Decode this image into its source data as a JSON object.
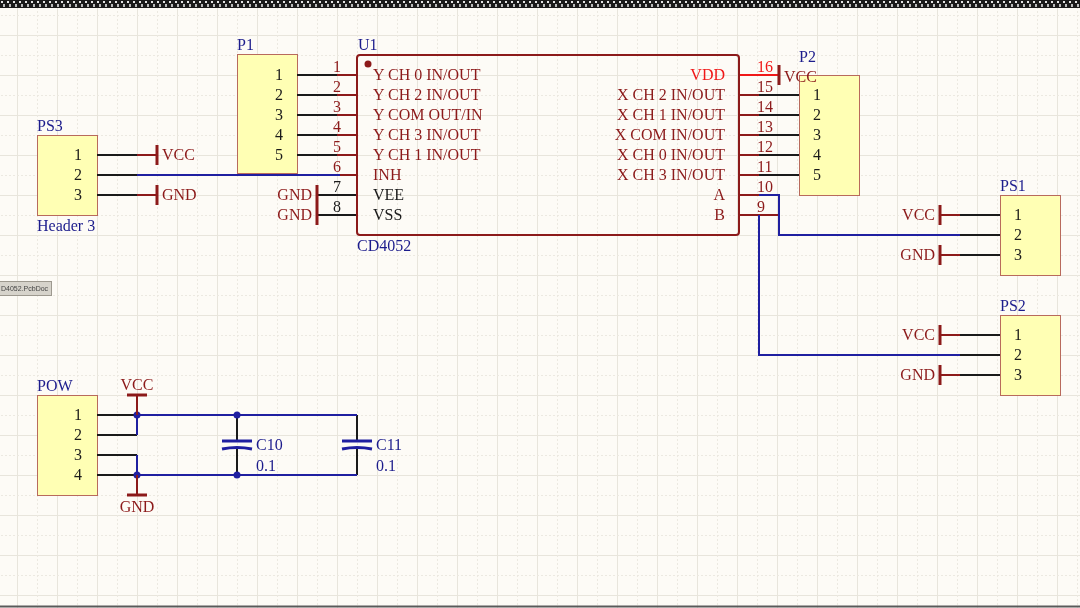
{
  "components": [
    {
      "kind": "header",
      "designator": "PS3",
      "comment": "Header 3",
      "pins": [
        "1",
        "2",
        "3"
      ]
    },
    {
      "kind": "header",
      "designator": "P1",
      "pins": [
        "1",
        "2",
        "3",
        "4",
        "5"
      ]
    },
    {
      "kind": "ic",
      "designator": "U1",
      "comment": "CD4052",
      "left_pins": [
        {
          "number": "1",
          "name": "Y CH 0 IN/OUT",
          "color": "#8c1a1a"
        },
        {
          "number": "2",
          "name": "Y CH 2 IN/OUT",
          "color": "#8c1a1a"
        },
        {
          "number": "3",
          "name": "Y COM OUT/IN",
          "color": "#8c1a1a"
        },
        {
          "number": "4",
          "name": "Y CH 3 IN/OUT",
          "color": "#8c1a1a"
        },
        {
          "number": "5",
          "name": "Y CH 1 IN/OUT",
          "color": "#8c1a1a"
        },
        {
          "number": "6",
          "name": "INH",
          "color": "#8c1a1a"
        },
        {
          "number": "7",
          "name": "VEE",
          "color": "#1a1a1a"
        },
        {
          "number": "8",
          "name": "VSS",
          "color": "#1a1a1a"
        }
      ],
      "right_pins": [
        {
          "number": "16",
          "name": "VDD",
          "color": "#f01818"
        },
        {
          "number": "15",
          "name": "X CH 2 IN/OUT",
          "color": "#8c1a1a"
        },
        {
          "number": "14",
          "name": "X CH 1 IN/OUT",
          "color": "#8c1a1a"
        },
        {
          "number": "13",
          "name": "X COM IN/OUT",
          "color": "#8c1a1a"
        },
        {
          "number": "12",
          "name": "X CH 0 IN/OUT",
          "color": "#8c1a1a"
        },
        {
          "number": "11",
          "name": "X CH 3 IN/OUT",
          "color": "#8c1a1a"
        },
        {
          "number": "10",
          "name": "A",
          "color": "#8c1a1a"
        },
        {
          "number": "9",
          "name": "B",
          "color": "#8c1a1a"
        }
      ]
    },
    {
      "kind": "header",
      "designator": "P2",
      "pins": [
        "1",
        "2",
        "3",
        "4",
        "5"
      ]
    },
    {
      "kind": "header",
      "designator": "PS1",
      "pins": [
        "1",
        "2",
        "3"
      ]
    },
    {
      "kind": "header",
      "designator": "PS2",
      "pins": [
        "1",
        "2",
        "3"
      ]
    },
    {
      "kind": "header",
      "designator": "POW",
      "pins": [
        "1",
        "2",
        "3",
        "4"
      ]
    },
    {
      "kind": "capacitor",
      "designator": "C10",
      "value": "0.1"
    },
    {
      "kind": "capacitor",
      "designator": "C11",
      "value": "0.1"
    }
  ],
  "power_ports": [
    {
      "label": "VCC"
    },
    {
      "label": "GND"
    },
    {
      "label": "GND"
    },
    {
      "label": "GND"
    },
    {
      "label": "VCC"
    },
    {
      "label": "VCC"
    },
    {
      "label": "GND"
    },
    {
      "label": "VCC"
    },
    {
      "label": "GND"
    },
    {
      "label": "VCC"
    },
    {
      "label": "GND"
    }
  ],
  "document_tab": {
    "label": "D4052.PcbDoc"
  }
}
